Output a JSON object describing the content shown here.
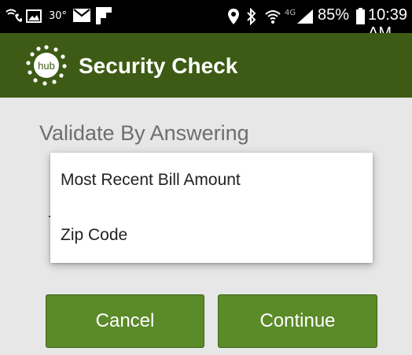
{
  "status_bar": {
    "temperature": "30°",
    "battery": "85%",
    "time": "10:39 AM",
    "network": "4G",
    "icons": [
      "wifi-calling-icon",
      "image-icon",
      "mail-icon",
      "flipboard-icon",
      "location-icon",
      "bluetooth-icon",
      "wifi-icon",
      "signal-icon",
      "battery-icon"
    ]
  },
  "app_bar": {
    "logo_text": "hub",
    "title": "Security Check",
    "color": "#3d5b14"
  },
  "content": {
    "heading": "Validate By Answering"
  },
  "dropdown": {
    "options": [
      {
        "label": "Most Recent Bill Amount"
      },
      {
        "label": "Zip Code"
      }
    ]
  },
  "buttons": {
    "cancel": "Cancel",
    "continue": "Continue",
    "color": "#5b8a29"
  }
}
